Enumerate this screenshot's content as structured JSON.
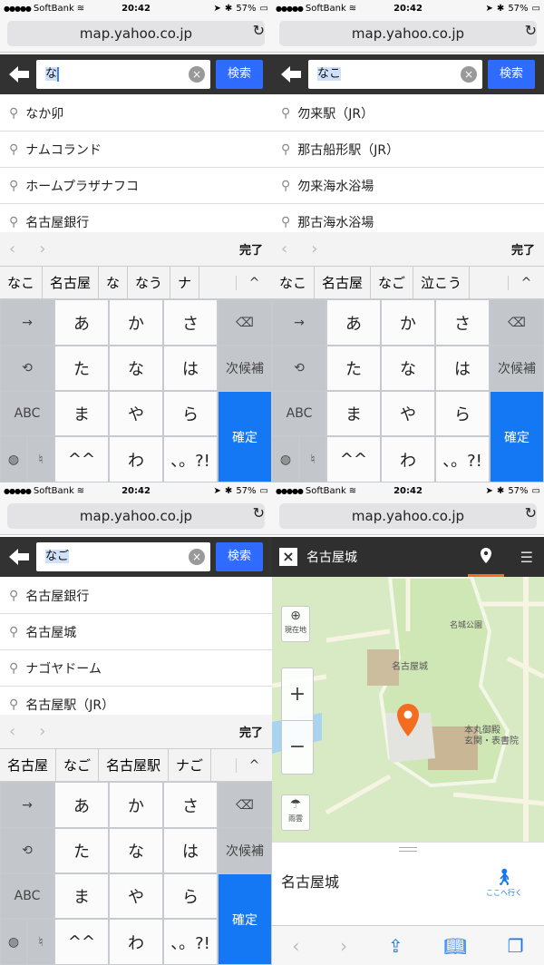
{
  "status_bar": {
    "carrier": "SoftBank",
    "time": "20:42",
    "battery": "57%"
  },
  "url_bar": {
    "url": "map.yahoo.co.jp"
  },
  "search_button_label": "検索",
  "keyboard": {
    "done_label": "完了",
    "keys": {
      "row1": [
        "あ",
        "か",
        "さ"
      ],
      "row2": [
        "た",
        "な",
        "は"
      ],
      "row3": [
        "ま",
        "や",
        "ら"
      ],
      "row4": [
        "^^",
        "わ",
        "、。?!"
      ],
      "arrow": "→",
      "undo": "⟲",
      "abc": "ABC",
      "next_candidate": "次候補",
      "confirm": "確定"
    }
  },
  "panels": [
    {
      "query": "な",
      "suggestions": [
        "なか卯",
        "ナムコランド",
        "ホームプラザナフコ",
        "名古屋銀行"
      ],
      "candidates": [
        "なこ",
        "名古屋",
        "な",
        "なう",
        "ナ"
      ]
    },
    {
      "query": "なこ",
      "suggestions": [
        "勿来駅（JR）",
        "那古船形駅（JR）",
        "勿来海水浴場",
        "那古海水浴場"
      ],
      "candidates": [
        "なこ",
        "名古屋",
        "なご",
        "泣こう"
      ]
    },
    {
      "query": "なご",
      "suggestions": [
        "名古屋銀行",
        "名古屋城",
        "ナゴヤドーム",
        "名古屋駅（JR）"
      ],
      "candidates": [
        "名古屋",
        "なご",
        "名古屋駅",
        "ナご"
      ]
    }
  ],
  "map_panel": {
    "title": "名古屋城",
    "map_labels": {
      "park": "名城公園",
      "castle": "名古屋城",
      "palace": "本丸御殿\n玄関・表書院"
    },
    "controls": {
      "current_location": "現在地",
      "zoom_in": "+",
      "zoom_out": "−",
      "rain": "雨雲"
    },
    "place_name": "名古屋城",
    "go_here": "ここへ行く"
  },
  "colors": {
    "accent": "#f36d21",
    "keyboard_blue": "#1478f5",
    "search_blue": "#2f6bff"
  }
}
